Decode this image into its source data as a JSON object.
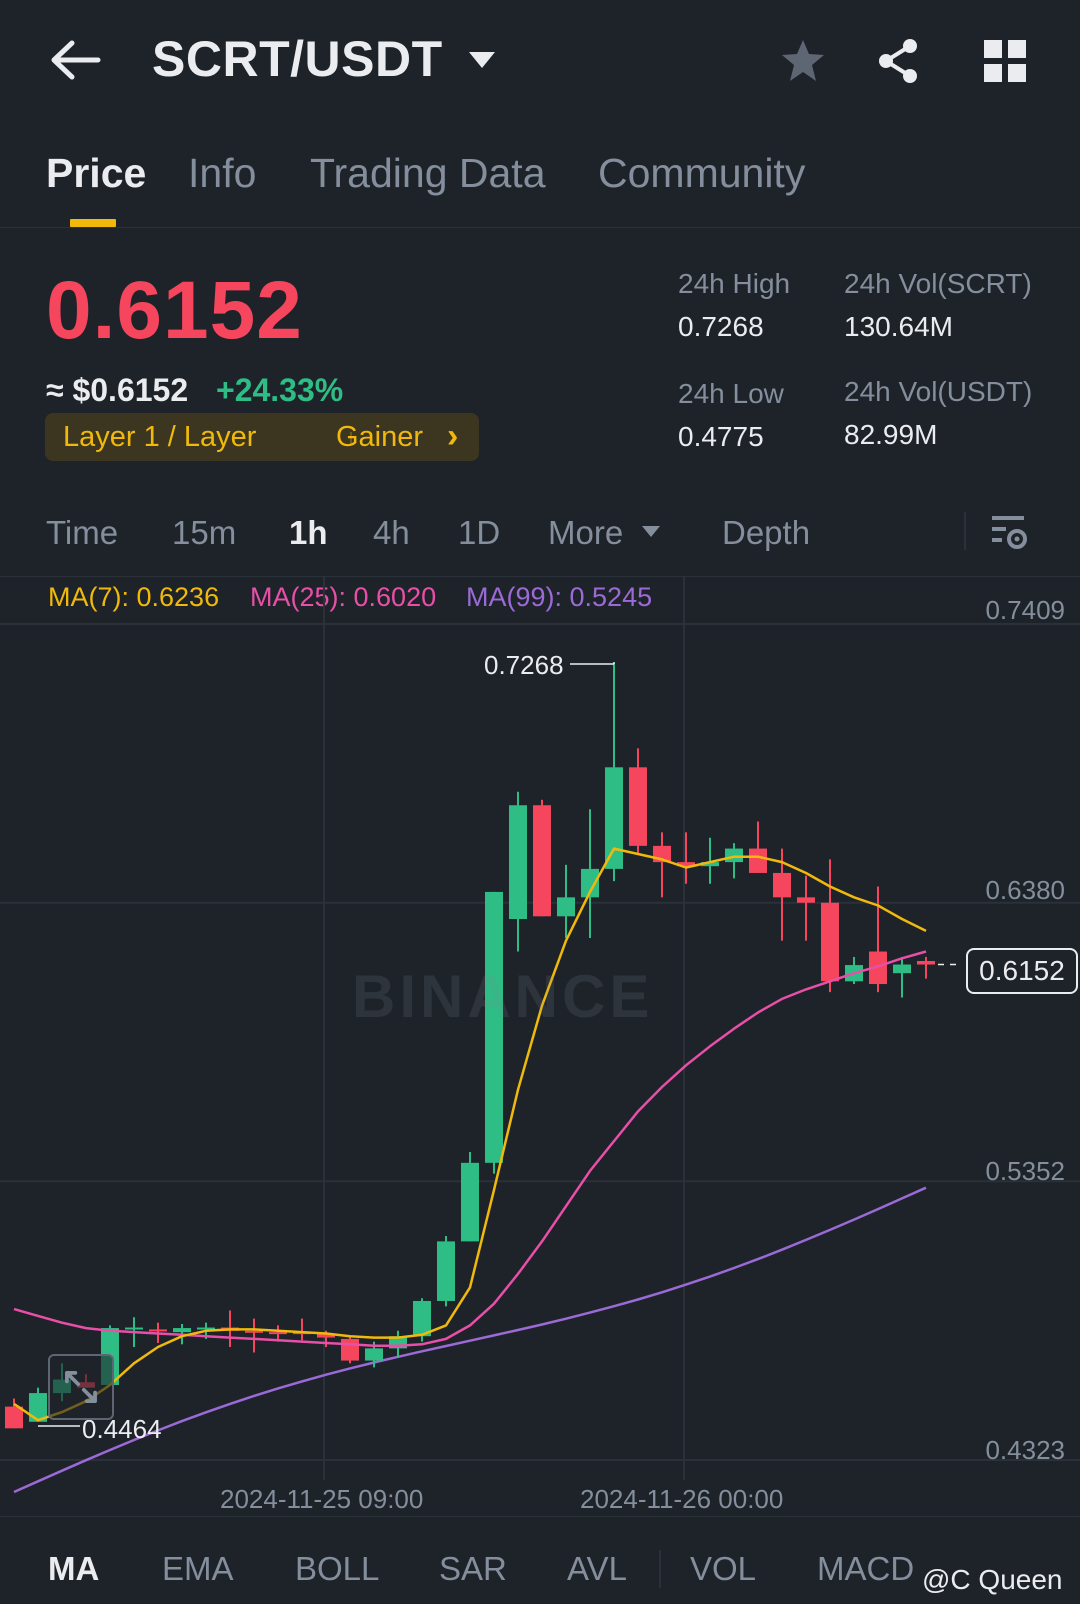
{
  "header": {
    "pair": "SCRT/USDT",
    "icons": [
      "back-arrow-icon",
      "caret-down-icon",
      "star-icon",
      "share-icon",
      "grid-icon"
    ]
  },
  "tabs": [
    "Price",
    "Info",
    "Trading Data",
    "Community"
  ],
  "active_tab": "Price",
  "price": {
    "last": "0.6152",
    "usd": "≈ $0.6152",
    "change": "+24.33%",
    "tag_left": "Layer 1 / Layer",
    "tag_right": "Gainer",
    "tag_arrow": "›"
  },
  "stats": {
    "high_label": "24h High",
    "high_value": "0.7268",
    "low_label": "24h Low",
    "low_value": "0.4775",
    "vol_base_label": "24h Vol(SCRT)",
    "vol_base_value": "130.64M",
    "vol_quote_label": "24h Vol(USDT)",
    "vol_quote_value": "82.99M"
  },
  "timeframes": [
    "Time",
    "15m",
    "1h",
    "4h",
    "1D",
    "More",
    "Depth"
  ],
  "active_timeframe": "1h",
  "ma_legend": {
    "ma7": "MA(7): 0.6236",
    "ma25": "MA(25): 0.6020",
    "ma99": "MA(99): 0.5245"
  },
  "colors": {
    "up": "#2ebd85",
    "down": "#f6465d",
    "ma7": "#f0b90b",
    "ma25": "#e84fa8",
    "ma99": "#9b6ad6",
    "accent": "#f0b90b",
    "bg": "#1e2329"
  },
  "chart_data": {
    "type": "candlestick",
    "interval": "1h",
    "y_ticks": [
      "0.7409",
      "0.6380",
      "0.5352",
      "0.4323"
    ],
    "ylim": [
      0.4323,
      0.7409
    ],
    "x_ticks": [
      "2024-11-25 09:00",
      "2024-11-26 00:00"
    ],
    "current_price": "0.6152",
    "high_marker": "0.7268",
    "low_marker": "0.4464",
    "watermark": "BINANCE",
    "candles": [
      {
        "o": 0.452,
        "h": 0.455,
        "l": 0.444,
        "c": 0.444
      },
      {
        "o": 0.4464,
        "h": 0.459,
        "l": 0.4464,
        "c": 0.457
      },
      {
        "o": 0.457,
        "h": 0.468,
        "l": 0.454,
        "c": 0.462
      },
      {
        "o": 0.461,
        "h": 0.464,
        "l": 0.459,
        "c": 0.459
      },
      {
        "o": 0.46,
        "h": 0.482,
        "l": 0.46,
        "c": 0.481
      },
      {
        "o": 0.481,
        "h": 0.485,
        "l": 0.474,
        "c": 0.4812
      },
      {
        "o": 0.4805,
        "h": 0.483,
        "l": 0.4755,
        "c": 0.48
      },
      {
        "o": 0.4795,
        "h": 0.4825,
        "l": 0.475,
        "c": 0.481
      },
      {
        "o": 0.4808,
        "h": 0.483,
        "l": 0.477,
        "c": 0.4812
      },
      {
        "o": 0.4812,
        "h": 0.4875,
        "l": 0.474,
        "c": 0.48
      },
      {
        "o": 0.48,
        "h": 0.4845,
        "l": 0.472,
        "c": 0.4795
      },
      {
        "o": 0.4795,
        "h": 0.482,
        "l": 0.476,
        "c": 0.4793
      },
      {
        "o": 0.4795,
        "h": 0.4845,
        "l": 0.4765,
        "c": 0.479
      },
      {
        "o": 0.479,
        "h": 0.48,
        "l": 0.474,
        "c": 0.4775
      },
      {
        "o": 0.477,
        "h": 0.478,
        "l": 0.468,
        "c": 0.469
      },
      {
        "o": 0.469,
        "h": 0.476,
        "l": 0.4665,
        "c": 0.4735
      },
      {
        "o": 0.4735,
        "h": 0.48,
        "l": 0.47,
        "c": 0.478
      },
      {
        "o": 0.478,
        "h": 0.492,
        "l": 0.476,
        "c": 0.491
      },
      {
        "o": 0.491,
        "h": 0.515,
        "l": 0.489,
        "c": 0.513
      },
      {
        "o": 0.513,
        "h": 0.546,
        "l": 0.513,
        "c": 0.542
      },
      {
        "o": 0.542,
        "h": 0.642,
        "l": 0.538,
        "c": 0.642
      },
      {
        "o": 0.632,
        "h": 0.679,
        "l": 0.62,
        "c": 0.674
      },
      {
        "o": 0.674,
        "h": 0.676,
        "l": 0.633,
        "c": 0.633
      },
      {
        "o": 0.633,
        "h": 0.652,
        "l": 0.625,
        "c": 0.64
      },
      {
        "o": 0.64,
        "h": 0.6725,
        "l": 0.625,
        "c": 0.6505
      },
      {
        "o": 0.6505,
        "h": 0.7268,
        "l": 0.646,
        "c": 0.688
      },
      {
        "o": 0.688,
        "h": 0.695,
        "l": 0.656,
        "c": 0.659
      },
      {
        "o": 0.659,
        "h": 0.664,
        "l": 0.64,
        "c": 0.653
      },
      {
        "o": 0.653,
        "h": 0.664,
        "l": 0.645,
        "c": 0.6515
      },
      {
        "o": 0.6515,
        "h": 0.662,
        "l": 0.645,
        "c": 0.653
      },
      {
        "o": 0.653,
        "h": 0.66,
        "l": 0.647,
        "c": 0.658
      },
      {
        "o": 0.658,
        "h": 0.668,
        "l": 0.65,
        "c": 0.649
      },
      {
        "o": 0.649,
        "h": 0.658,
        "l": 0.624,
        "c": 0.64
      },
      {
        "o": 0.64,
        "h": 0.648,
        "l": 0.624,
        "c": 0.638
      },
      {
        "o": 0.638,
        "h": 0.654,
        "l": 0.605,
        "c": 0.609
      },
      {
        "o": 0.609,
        "h": 0.618,
        "l": 0.608,
        "c": 0.615
      },
      {
        "o": 0.62,
        "h": 0.644,
        "l": 0.605,
        "c": 0.608
      },
      {
        "o": 0.612,
        "h": 0.618,
        "l": 0.603,
        "c": 0.6152
      },
      {
        "o": 0.6165,
        "h": 0.618,
        "l": 0.61,
        "c": 0.6152
      }
    ],
    "ma7": [
      0.453,
      0.447,
      0.45,
      0.454,
      0.46,
      0.468,
      0.474,
      0.478,
      0.48,
      0.4805,
      0.4805,
      0.48,
      0.4795,
      0.479,
      0.478,
      0.4775,
      0.4775,
      0.4785,
      0.482,
      0.496,
      0.532,
      0.569,
      0.6,
      0.624,
      0.642,
      0.658,
      0.656,
      0.654,
      0.651,
      0.653,
      0.655,
      0.655,
      0.653,
      0.649,
      0.644,
      0.64,
      0.637,
      0.632,
      0.6276
    ],
    "ma25": [
      0.488,
      0.4855,
      0.483,
      0.481,
      0.48,
      0.4795,
      0.479,
      0.4785,
      0.478,
      0.4775,
      0.477,
      0.4765,
      0.476,
      0.4755,
      0.475,
      0.4745,
      0.4745,
      0.475,
      0.477,
      0.482,
      0.49,
      0.501,
      0.513,
      0.526,
      0.539,
      0.55,
      0.561,
      0.57,
      0.578,
      0.585,
      0.5915,
      0.5975,
      0.6025,
      0.606,
      0.609,
      0.612,
      0.6145,
      0.6175,
      0.62
    ]
  },
  "indicators": [
    "MA",
    "EMA",
    "BOLL",
    "SAR",
    "AVL",
    "VOL",
    "MACD"
  ],
  "active_indicator": "MA",
  "credit": "@C Queen"
}
